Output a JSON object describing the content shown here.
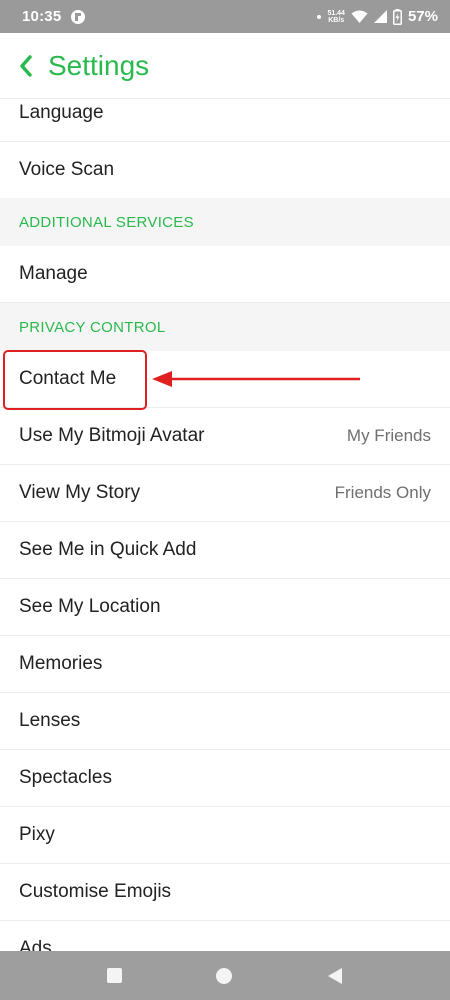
{
  "status_bar": {
    "time": "10:35",
    "net_speed_value": "51.44",
    "net_speed_unit": "KB/s",
    "battery": "57%"
  },
  "header": {
    "title": "Settings"
  },
  "list": {
    "rows_top": [
      {
        "label": "Language"
      },
      {
        "label": "Voice Scan"
      }
    ],
    "section_additional": "ADDITIONAL SERVICES",
    "manage": "Manage",
    "section_privacy": "PRIVACY CONTROL",
    "contact_me": "Contact Me",
    "privacy_rows": [
      {
        "label": "Use My Bitmoji Avatar",
        "value": "My Friends"
      },
      {
        "label": "View My Story",
        "value": "Friends Only"
      },
      {
        "label": "See Me in Quick Add"
      },
      {
        "label": "See My Location"
      },
      {
        "label": "Memories"
      },
      {
        "label": "Lenses"
      },
      {
        "label": "Spectacles"
      },
      {
        "label": "Pixy"
      },
      {
        "label": "Customise Emojis"
      },
      {
        "label": "Ads"
      }
    ]
  },
  "colors": {
    "accent_green": "#2ab94d",
    "annotation_red": "#e02020",
    "system_bar_gray": "#9a9a9a"
  },
  "icons": {
    "back": "chevron-left-icon",
    "nav_recents": "square-icon",
    "nav_home": "circle-icon",
    "nav_back": "triangle-back-icon"
  }
}
